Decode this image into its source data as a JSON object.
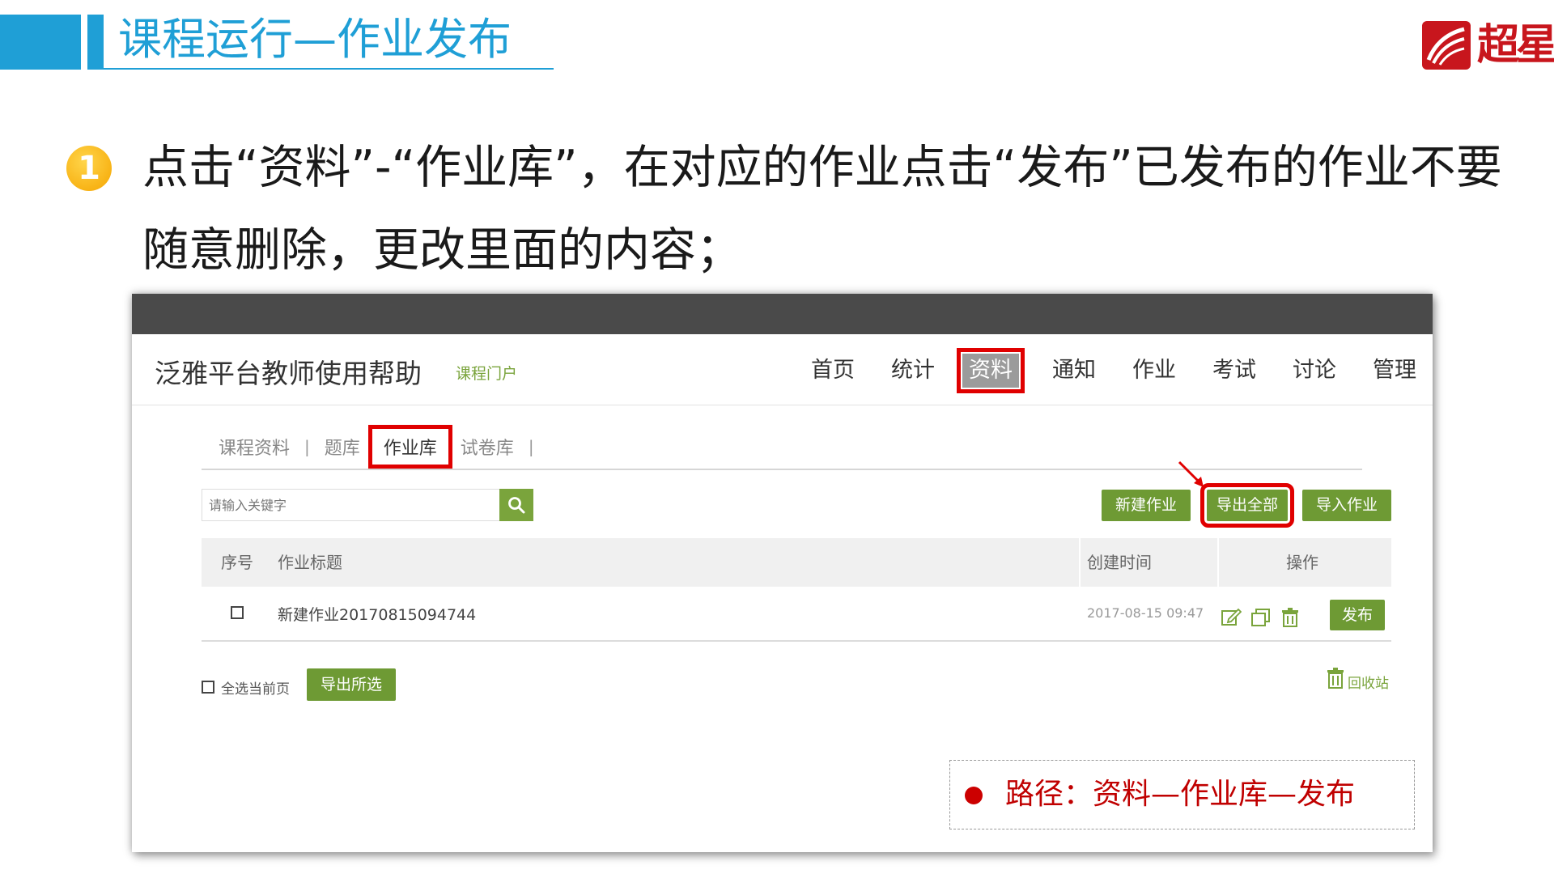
{
  "slide": {
    "title": "课程运行—作业发布",
    "logo_text": "超星",
    "step_number": "1",
    "instruction": "点击“资料”-“作业库”，在对应的作业点击“发布”已发布的作业不要随意删除，更改里面的内容；"
  },
  "app": {
    "site_title": "泛雅平台教师使用帮助",
    "portal_link": "课程门户",
    "nav": [
      "首页",
      "统计",
      "资料",
      "通知",
      "作业",
      "考试",
      "讨论",
      "管理"
    ],
    "nav_active": "资料",
    "subtabs": [
      "课程资料",
      "题库",
      "作业库",
      "试卷库"
    ],
    "subtab_active": "作业库",
    "separator": "|",
    "search": {
      "placeholder": "请输入关键字"
    },
    "buttons": {
      "new": "新建作业",
      "export_all": "导出全部",
      "import": "导入作业",
      "publish": "发布",
      "export_selected": "导出所选"
    },
    "table": {
      "headers": {
        "index": "序号",
        "title": "作业标题",
        "created": "创建时间",
        "ops": "操作"
      },
      "rows": [
        {
          "title": "新建作业20170815094744",
          "created": "2017-08-15 09:47",
          "checked": false
        }
      ]
    },
    "select_all_label": "全选当前页",
    "recycle_label": "回收站"
  },
  "note": {
    "path": "路径：资料—作业库—发布"
  },
  "colors": {
    "slide_blue": "#1f9fd6",
    "green": "#6e9a34",
    "highlight_red": "#e00000",
    "note_red": "#c00000",
    "topbar": "#4a4a4a"
  }
}
